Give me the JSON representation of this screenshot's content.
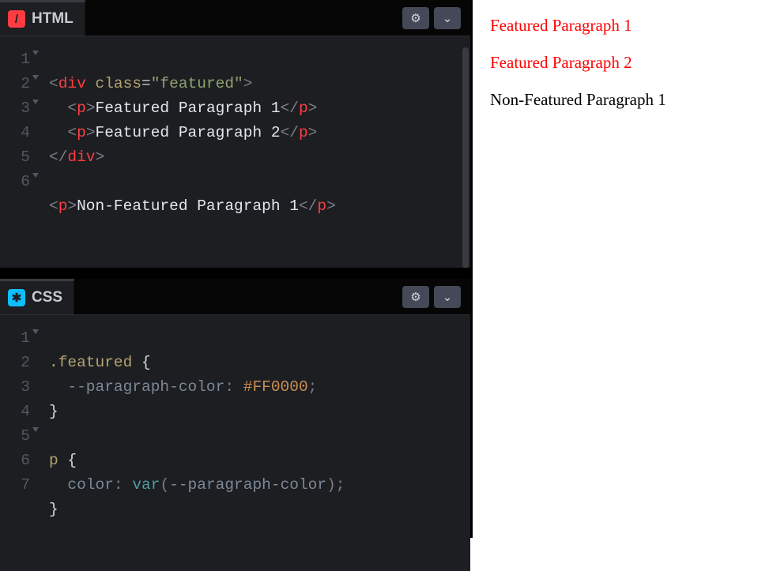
{
  "panels": {
    "html": {
      "title": "HTML",
      "icon_glyph": "/",
      "line_numbers": [
        "1",
        "2",
        "3",
        "4",
        "5",
        "6"
      ],
      "folds": [
        true,
        true,
        true,
        false,
        false,
        true
      ],
      "code": {
        "l1": {
          "tag": "div",
          "attr": "class",
          "val": "\"featured\""
        },
        "l2": {
          "tag": "p",
          "text": "Featured Paragraph 1"
        },
        "l3": {
          "tag": "p",
          "text": "Featured Paragraph 2"
        },
        "l4": {
          "close": "div"
        },
        "l6": {
          "tag": "p",
          "text": "Non-Featured Paragraph 1"
        }
      }
    },
    "css": {
      "title": "CSS",
      "icon_glyph": "✱",
      "line_numbers": [
        "1",
        "2",
        "3",
        "4",
        "5",
        "6",
        "7"
      ],
      "folds": [
        true,
        false,
        false,
        false,
        true,
        false,
        false
      ],
      "code": {
        "sel1": ".featured",
        "prop1": "--paragraph-color",
        "val1": "#FF0000",
        "sel2": "p",
        "prop2": "color",
        "fn2": "var",
        "arg2": "--paragraph-color"
      }
    }
  },
  "preview": {
    "featured_p1": "Featured Paragraph 1",
    "featured_p2": "Featured Paragraph 2",
    "non_featured_p1": "Non-Featured Paragraph 1"
  },
  "icons": {
    "gear": "⚙",
    "chevron_down": "⌄"
  }
}
